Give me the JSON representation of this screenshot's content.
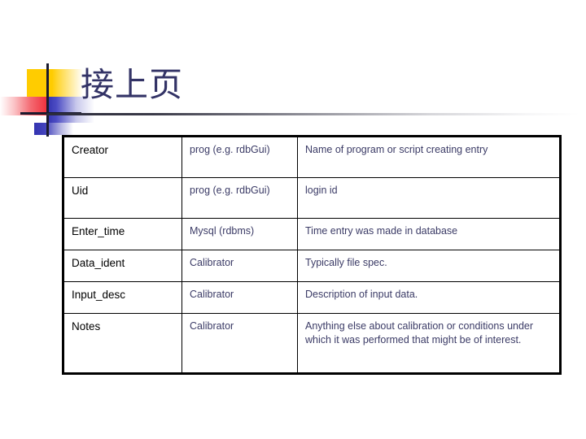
{
  "slide": {
    "title": "接上页",
    "title_color": "#333366",
    "background_color": "#ffffff",
    "decoration": {
      "name": "geometric-design-motif",
      "yellow": "#ffcc00",
      "red": "#f0303c",
      "blue": "#3333b0",
      "line": "#1a1a2e"
    },
    "rule_color_start": "#2b2b3a",
    "rule_color_end": "#ffffff"
  },
  "table": {
    "column_count": 3,
    "row_count": 6,
    "border_color": "#000000",
    "col1_text_color": "#000000",
    "col2_text_color": "#3b3b66",
    "col3_text_color": "#3b3b66",
    "rows": [
      {
        "field": "Creator",
        "source": "prog (e.g. rdbGui)",
        "description": "Name of program or script creating entry"
      },
      {
        "field": "Uid",
        "source": "prog (e.g. rdbGui)",
        "description": "login id"
      },
      {
        "field": "Enter_time",
        "source": "Mysql (rdbms)",
        "description": "Time entry was made in database"
      },
      {
        "field": "Data_ident",
        "source": "Calibrator",
        "description": "Typically file spec."
      },
      {
        "field": "Input_desc",
        "source": "Calibrator",
        "description": "Description of input data."
      },
      {
        "field": "Notes",
        "source": "Calibrator",
        "description": "Anything else about calibration or conditions under which it was performed that might be of interest."
      }
    ]
  }
}
